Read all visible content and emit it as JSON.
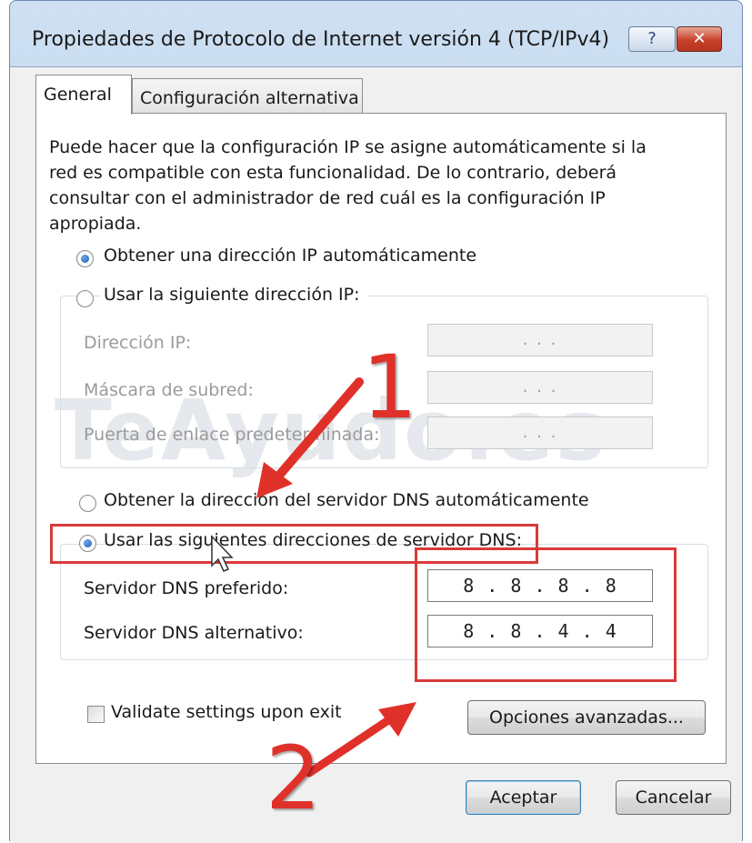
{
  "window": {
    "title": "Propiedades de Protocolo de Internet versión 4 (TCP/IPv4)",
    "help_glyph": "?",
    "close_glyph": "✕"
  },
  "tabs": [
    {
      "label": "General",
      "active": true
    },
    {
      "label": "Configuración alternativa",
      "active": false
    }
  ],
  "description": "Puede hacer que la configuración IP se asigne automáticamente si la red es compatible con esta funcionalidad. De lo contrario, deberá consultar con el administrador de red cuál es la configuración IP apropiada.",
  "ip": {
    "auto_label": "Obtener una dirección IP automáticamente",
    "manual_label": "Usar la siguiente dirección IP:",
    "selected": "auto",
    "fields": [
      {
        "label": "Dirección IP:",
        "value": ". . ."
      },
      {
        "label": "Máscara de subred:",
        "value": ". . ."
      },
      {
        "label": "Puerta de enlace predeterminada:",
        "value": ". . ."
      }
    ]
  },
  "dns": {
    "auto_label": "Obtener la dirección del servidor DNS automáticamente",
    "manual_label": "Usar las siguientes direcciones de servidor DNS:",
    "selected": "manual",
    "fields": [
      {
        "label": "Servidor DNS preferido:",
        "value": "8 . 8 . 8 . 8"
      },
      {
        "label": "Servidor DNS alternativo:",
        "value": "8 . 8 . 4 . 4"
      }
    ]
  },
  "validate_label": "Validate settings upon exit",
  "validate_checked": false,
  "advanced_button": "Opciones avanzadas...",
  "ok_button": "Aceptar",
  "cancel_button": "Cancelar",
  "watermark": "TeAyudo.es",
  "annotations": {
    "step1": "1",
    "step2": "2",
    "color": "#e0302a"
  }
}
